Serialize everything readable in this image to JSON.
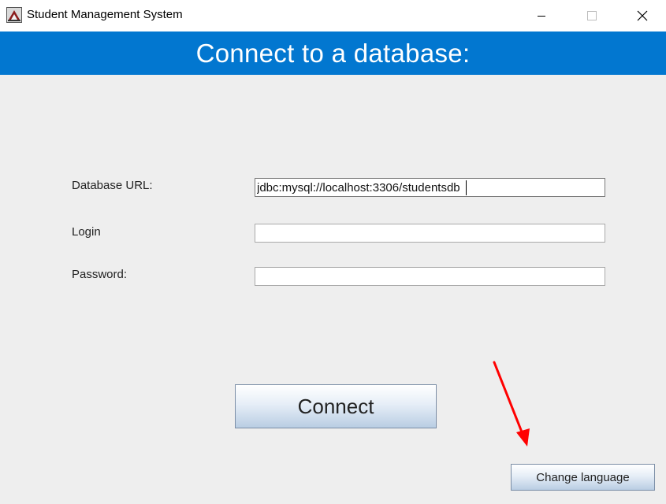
{
  "window": {
    "title": "Student Management System",
    "icons": [
      "app-icon",
      "minimize-icon",
      "maximize-icon",
      "close-icon"
    ]
  },
  "header": {
    "title": "Connect to a database:",
    "color": "#0277d0"
  },
  "form": {
    "url_label": "Database URL:",
    "url_value": "jdbc:mysql://localhost:3306/studentsdb",
    "login_label": "Login",
    "login_value": "",
    "password_label": "Password:",
    "password_value": ""
  },
  "actions": {
    "connect_label": "Connect",
    "change_language_label": "Change language"
  },
  "annotation": {
    "arrow_color": "#ff0000"
  }
}
